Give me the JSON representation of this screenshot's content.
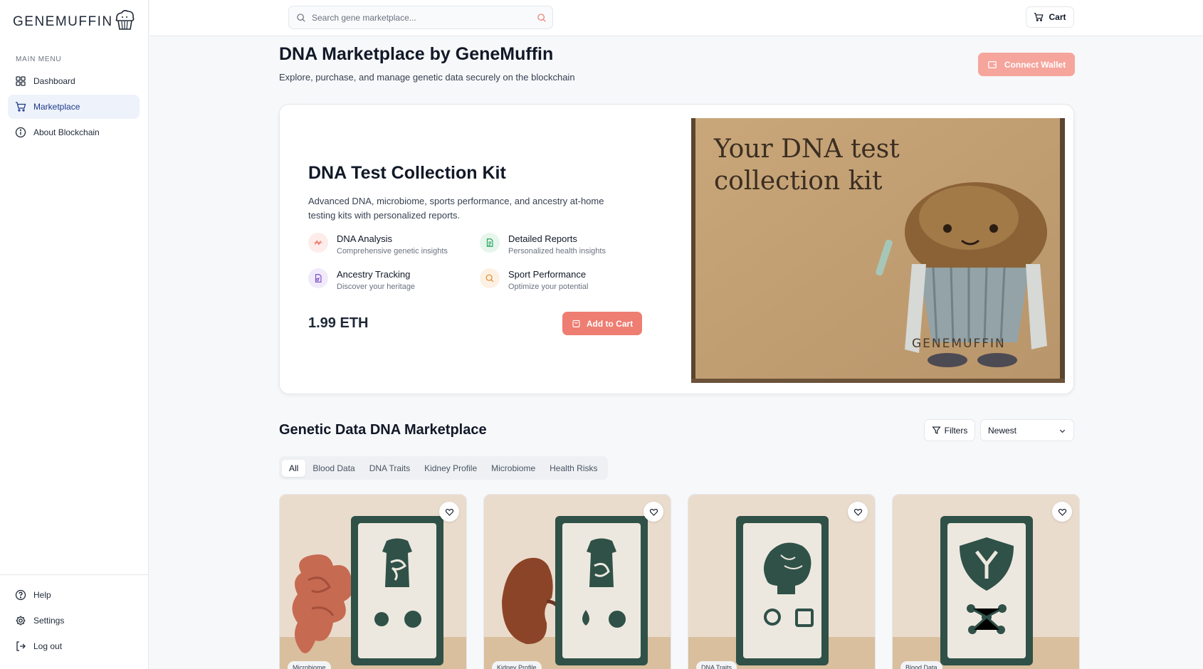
{
  "app": {
    "logo_text": "GENEMUFFIN"
  },
  "sidebar": {
    "menu_title": "MAIN MENU",
    "items": [
      {
        "label": "Dashboard",
        "icon": "grid-icon"
      },
      {
        "label": "Marketplace",
        "icon": "cart-icon",
        "active": true
      },
      {
        "label": "About Blockchain",
        "icon": "info-icon"
      }
    ],
    "bottom_items": [
      {
        "label": "Help",
        "icon": "help-circle-icon"
      },
      {
        "label": "Settings",
        "icon": "gear-icon"
      },
      {
        "label": "Log out",
        "icon": "logout-icon"
      }
    ]
  },
  "header": {
    "search_placeholder": "Search gene marketplace...",
    "cart_label": "Cart"
  },
  "page": {
    "title": "DNA Marketplace by GeneMuffin",
    "subtitle": "Explore, purchase, and manage genetic data securely on the blockchain",
    "connect_wallet_label": "Connect Wallet"
  },
  "hero": {
    "title": "DNA Test Collection Kit",
    "description": "Advanced DNA, microbiome, sports performance, and ancestry at-home testing kits with personalized reports.",
    "features": [
      {
        "title": "DNA Analysis",
        "subtitle": "Comprehensive genetic insights",
        "icon": "dna-icon",
        "color": "#ef6f62"
      },
      {
        "title": "Detailed Reports",
        "subtitle": "Personalized health insights",
        "icon": "document-icon",
        "color": "#22a35a"
      },
      {
        "title": "Ancestry Tracking",
        "subtitle": "Discover your heritage",
        "icon": "file-icon",
        "color": "#7c4dcc"
      },
      {
        "title": "Sport Performance",
        "subtitle": "Optimize your potential",
        "icon": "search-icon",
        "color": "#e58a2e"
      }
    ],
    "price": "1.99 ETH",
    "add_to_cart_label": "Add to Cart",
    "image": {
      "box_line1": "Your DNA test",
      "box_line2": "collection kit",
      "box_brand": "GENEMUFFIN"
    }
  },
  "marketplace": {
    "title": "Genetic Data DNA Marketplace",
    "filters_label": "Filters",
    "sort_value": "Newest",
    "tabs": [
      "All",
      "Blood Data",
      "DNA Traits",
      "Kidney Profile",
      "Microbiome",
      "Health Risks"
    ],
    "active_tab": "All",
    "products": [
      {
        "category": "Microbiome"
      },
      {
        "category": "Kidney Profile"
      },
      {
        "category": "DNA Traits"
      },
      {
        "category": "Blood Data"
      }
    ]
  },
  "colors": {
    "accent": "#ee7d72",
    "accent_light": "#f6a59c",
    "active_nav_bg": "#eef2fb",
    "kit_green": "#2f5148"
  }
}
